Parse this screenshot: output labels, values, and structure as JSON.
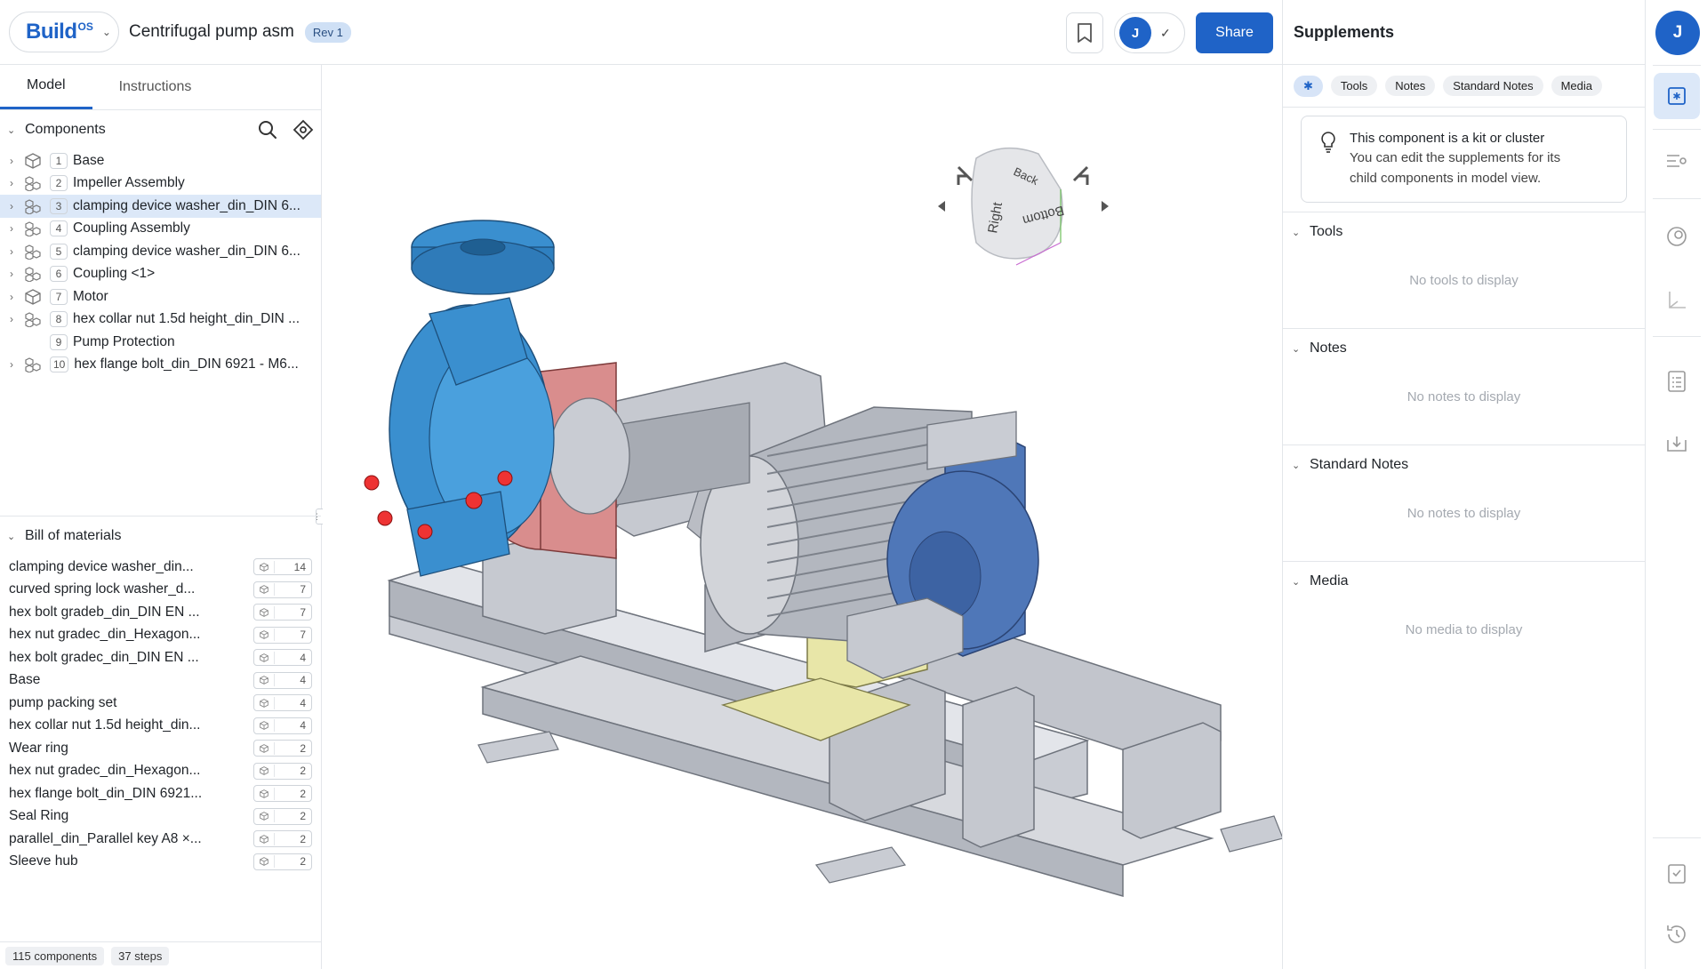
{
  "topbar": {
    "brand_word": "Build",
    "brand_sup": "OS",
    "doc_title": "Centrifugal pump asm",
    "revision": "Rev 1",
    "user_initial": "J",
    "share_label": "Share"
  },
  "left": {
    "tabs": [
      "Model",
      "Instructions"
    ],
    "components_title": "Components",
    "components": [
      {
        "num": "1",
        "label": "Base"
      },
      {
        "num": "2",
        "label": "Impeller Assembly"
      },
      {
        "num": "3",
        "label": "clamping device washer_din_DIN 6..."
      },
      {
        "num": "4",
        "label": "Coupling Assembly"
      },
      {
        "num": "5",
        "label": "clamping device washer_din_DIN 6..."
      },
      {
        "num": "6",
        "label": "Coupling <1>"
      },
      {
        "num": "7",
        "label": "Motor"
      },
      {
        "num": "8",
        "label": "hex collar nut 1.5d height_din_DIN ..."
      },
      {
        "num": "9",
        "label": "Pump Protection"
      },
      {
        "num": "10",
        "label": "hex flange bolt_din_DIN 6921 - M6..."
      }
    ],
    "bom_title": "Bill of materials",
    "bom": [
      {
        "label": "clamping device washer_din...",
        "qty": "14"
      },
      {
        "label": "curved spring lock washer_d...",
        "qty": "7"
      },
      {
        "label": "hex bolt gradeb_din_DIN EN ...",
        "qty": "7"
      },
      {
        "label": "hex nut gradec_din_Hexagon...",
        "qty": "7"
      },
      {
        "label": "hex bolt gradec_din_DIN EN ...",
        "qty": "4"
      },
      {
        "label": "Base",
        "qty": "4"
      },
      {
        "label": "pump packing set",
        "qty": "4"
      },
      {
        "label": "hex collar nut 1.5d height_din...",
        "qty": "4"
      },
      {
        "label": "Wear ring",
        "qty": "2"
      },
      {
        "label": "hex nut gradec_din_Hexagon...",
        "qty": "2"
      },
      {
        "label": "hex flange bolt_din_DIN 6921...",
        "qty": "2"
      },
      {
        "label": "Seal Ring",
        "qty": "2"
      },
      {
        "label": "parallel_din_Parallel key A8 ×...",
        "qty": "2"
      },
      {
        "label": "Sleeve hub",
        "qty": "2"
      }
    ],
    "footer": {
      "components": "115 components",
      "steps": "37 steps"
    }
  },
  "viewer": {
    "cube_faces": {
      "back": "Back",
      "right": "Right",
      "bottom": "Bottom"
    }
  },
  "supplements": {
    "title": "Supplements",
    "chips": [
      "✱",
      "Tools",
      "Notes",
      "Standard Notes",
      "Media"
    ],
    "info_title": "This component is a kit or cluster",
    "info_body": "You can edit the supplements for its child components in model view.",
    "sections": [
      {
        "title": "Tools",
        "empty": "No tools to display"
      },
      {
        "title": "Notes",
        "empty": "No notes to display"
      },
      {
        "title": "Standard Notes",
        "empty": "No notes to display"
      },
      {
        "title": "Media",
        "empty": "No media to display"
      }
    ]
  },
  "rail": {
    "user_initial": "J"
  }
}
